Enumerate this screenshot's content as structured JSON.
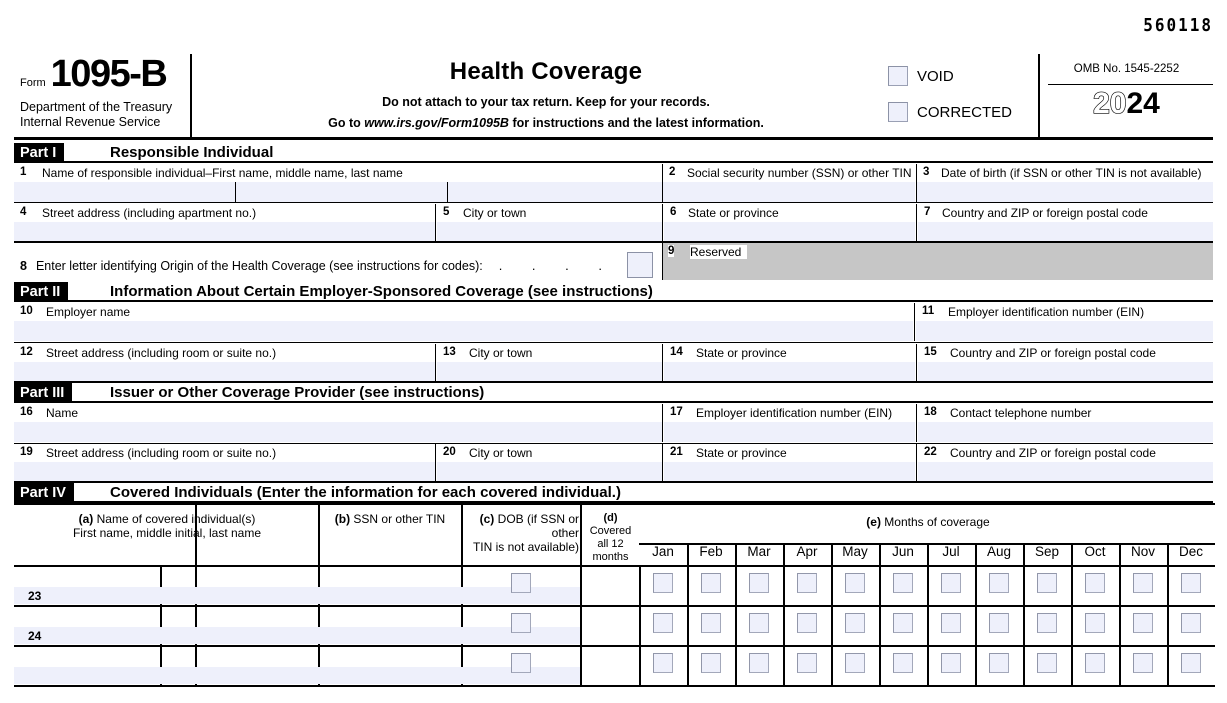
{
  "form": {
    "scan_code": "560118",
    "form_label": "Form",
    "form_number": "1095-B",
    "agency_line1": "Department of the Treasury",
    "agency_line2": "Internal Revenue Service",
    "title": "Health Coverage",
    "subtitle1": "Do not attach to your tax return. Keep for your records.",
    "subtitle2_pre": "Go to ",
    "subtitle2_url": "www.irs.gov/Form1095B",
    "subtitle2_post": " for instructions and the latest information.",
    "void_label": "VOID",
    "corrected_label": "CORRECTED",
    "omb_label": "OMB No. 1545-2252",
    "year_hollow": "20",
    "year_solid": "24"
  },
  "part1": {
    "tag": "Part I",
    "title": "Responsible Individual",
    "f1": {
      "num": "1",
      "caption": "Name of responsible individual–First name, middle name, last name"
    },
    "f2": {
      "num": "2",
      "caption": "Social security number (SSN) or other TIN"
    },
    "f3": {
      "num": "3",
      "caption": "Date of birth (if SSN or other TIN is not available)"
    },
    "f4": {
      "num": "4",
      "caption": "Street address (including apartment no.)"
    },
    "f5": {
      "num": "5",
      "caption": "City or town"
    },
    "f6": {
      "num": "6",
      "caption": "State or province"
    },
    "f7": {
      "num": "7",
      "caption": "Country and ZIP or foreign postal code"
    },
    "f8": {
      "num": "8",
      "caption": "Enter letter identifying Origin of the Health Coverage (see instructions for codes):",
      "dots": ". . . . .",
      "value": ""
    },
    "f9": {
      "num": "9",
      "caption": "Reserved"
    }
  },
  "part2": {
    "tag": "Part II",
    "title": "Information About Certain Employer-Sponsored Coverage",
    "note": " (see instructions)",
    "f10": {
      "num": "10",
      "caption": "Employer name"
    },
    "f11": {
      "num": "11",
      "caption": "Employer identification number (EIN)"
    },
    "f12": {
      "num": "12",
      "caption": "Street address (including room or suite no.)"
    },
    "f13": {
      "num": "13",
      "caption": "City or town"
    },
    "f14": {
      "num": "14",
      "caption": "State or province"
    },
    "f15": {
      "num": "15",
      "caption": "Country and ZIP or foreign postal code"
    }
  },
  "part3": {
    "tag": "Part III",
    "title": "Issuer or Other Coverage Provider",
    "note": " (see instructions)",
    "f16": {
      "num": "16",
      "caption": "Name"
    },
    "f17": {
      "num": "17",
      "caption": "Employer identification number (EIN)"
    },
    "f18": {
      "num": "18",
      "caption": "Contact telephone number"
    },
    "f19": {
      "num": "19",
      "caption": "Street address (including room or suite no.)"
    },
    "f20": {
      "num": "20",
      "caption": "City or town"
    },
    "f21": {
      "num": "21",
      "caption": "State or province"
    },
    "f22": {
      "num": "22",
      "caption": "Country and ZIP or foreign postal code"
    }
  },
  "part4": {
    "tag": "Part IV",
    "title": "Covered Individuals",
    "note": " (Enter the information for each covered individual.)",
    "col_a_marker": "(a)",
    "col_a_line1": " Name of covered individual(s)",
    "col_a_line2": "First name, middle initial, last name",
    "col_b_marker": "(b)",
    "col_b_text": " SSN or other TIN",
    "col_c_marker": "(c)",
    "col_c_line1": " DOB (if SSN or other",
    "col_c_line2": "TIN is not available)",
    "col_d_marker": "(d)",
    "col_d_line1": " Covered",
    "col_d_line2": "all 12 months",
    "col_e_marker": "(e)",
    "col_e_text": " Months of coverage",
    "months": [
      "Jan",
      "Feb",
      "Mar",
      "Apr",
      "May",
      "Jun",
      "Jul",
      "Aug",
      "Sep",
      "Oct",
      "Nov",
      "Dec"
    ],
    "rows": [
      {
        "num": "23",
        "name": "",
        "ssn": "",
        "dob": "",
        "covered_all": false,
        "month_checks": [
          false,
          false,
          false,
          false,
          false,
          false,
          false,
          false,
          false,
          false,
          false,
          false
        ]
      },
      {
        "num": "24",
        "name": "",
        "ssn": "",
        "dob": "",
        "covered_all": false,
        "month_checks": [
          false,
          false,
          false,
          false,
          false,
          false,
          false,
          false,
          false,
          false,
          false,
          false
        ]
      },
      {
        "num": "",
        "name": "",
        "ssn": "",
        "dob": "",
        "covered_all": false,
        "month_checks": [
          false,
          false,
          false,
          false,
          false,
          false,
          false,
          false,
          false,
          false,
          false,
          false
        ]
      }
    ]
  },
  "colors": {
    "field_fill": "#eef0fb",
    "reserved_shade": "#c6c6c6",
    "checkbox_border": "#9aa0b4",
    "rule": "#000000"
  }
}
